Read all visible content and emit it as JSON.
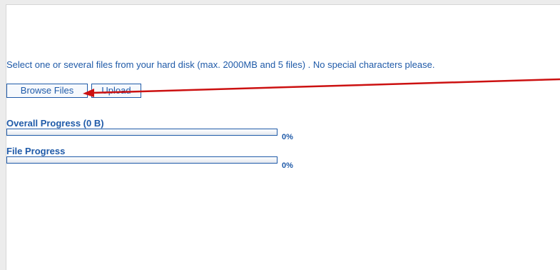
{
  "upload": {
    "instructions": "Select one or several files from your hard disk (max. 2000MB and 5 files) . No special characters please.",
    "browse_label": "Browse Files",
    "upload_label": "Upload"
  },
  "progress": {
    "overall_label": "Overall Progress (0 B)",
    "overall_value": 0,
    "overall_percent_text": "0%",
    "file_label": "File Progress",
    "file_value": 0,
    "file_percent_text": "0%"
  },
  "colors": {
    "accent": "#1f5aa8",
    "annotation_arrow": "#cc1111"
  }
}
